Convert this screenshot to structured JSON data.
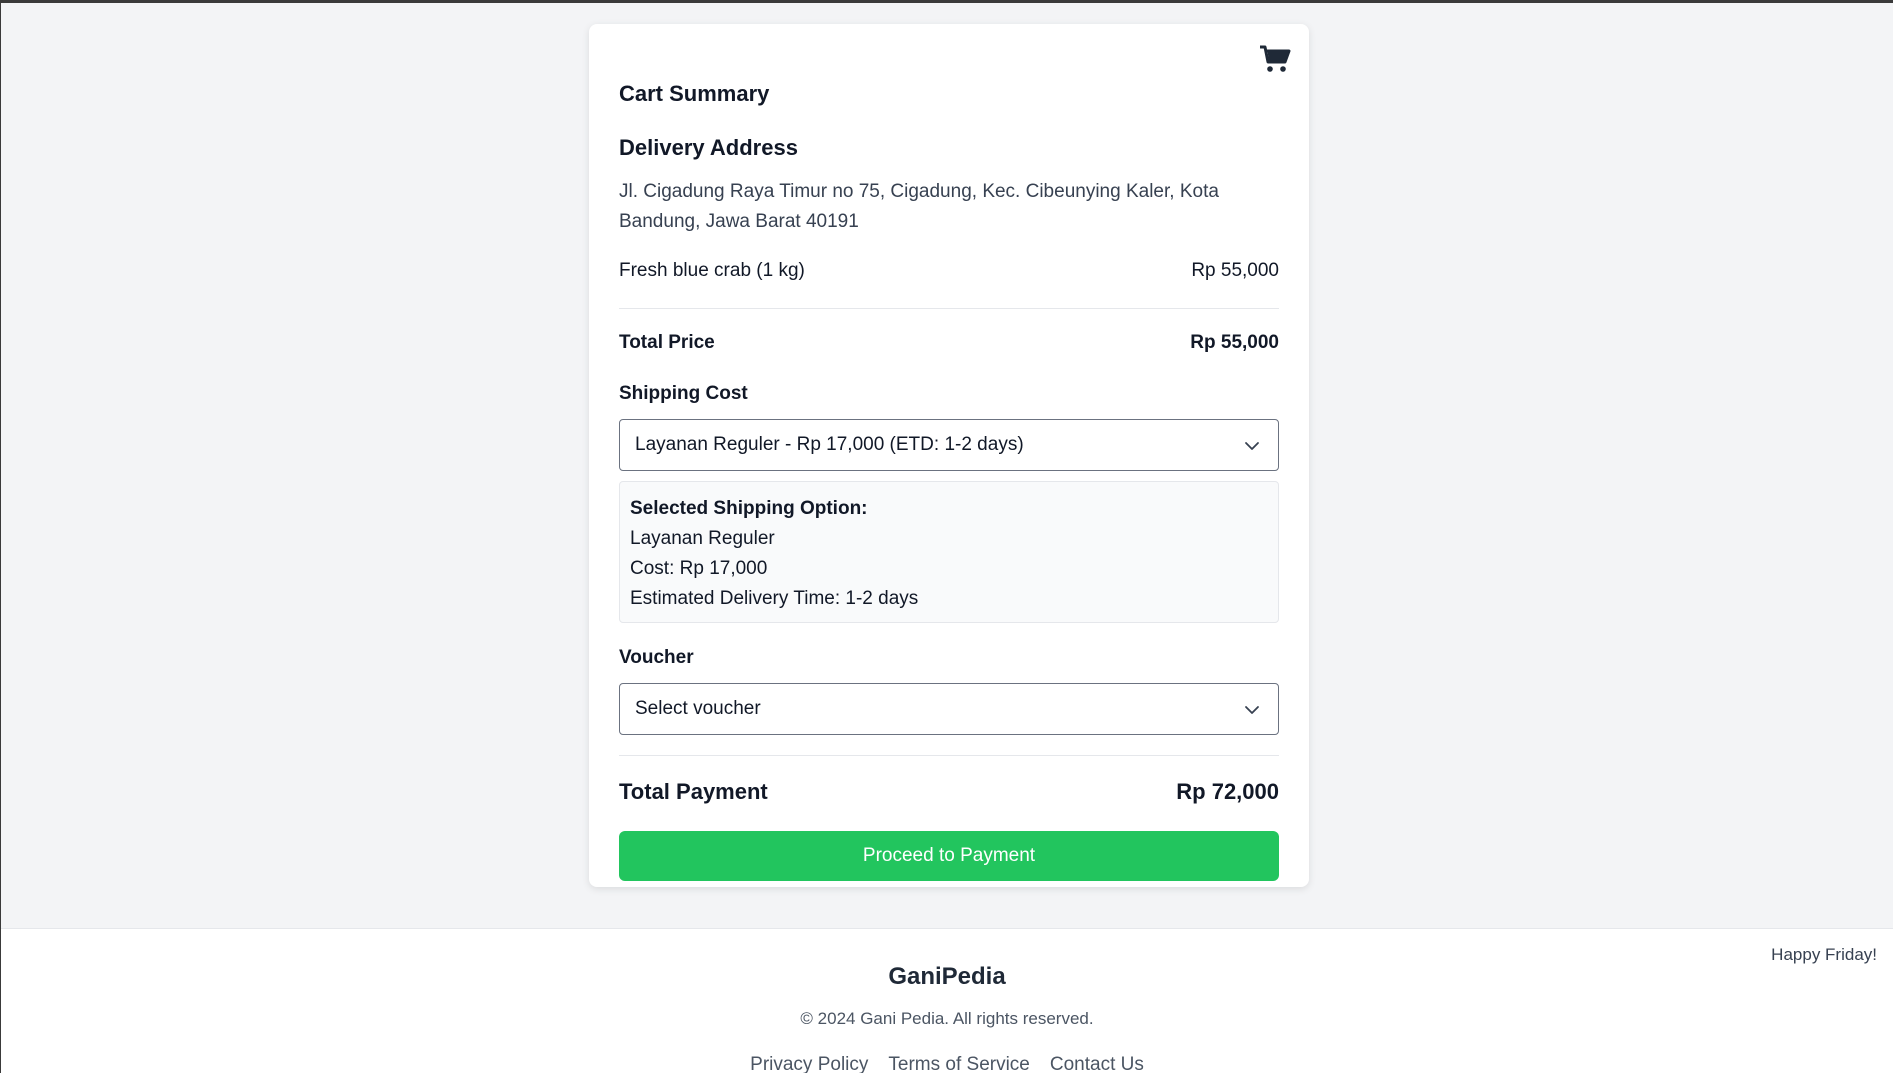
{
  "cart": {
    "title": "Cart Summary",
    "icon": "shopping-cart-icon"
  },
  "delivery": {
    "title": "Delivery Address",
    "address": "Jl. Cigadung Raya Timur no 75, Cigadung, Kec. Cibeunying Kaler, Kota Bandung, Jawa Barat 40191"
  },
  "items": [
    {
      "name": "Fresh blue crab (1 kg)",
      "price": "Rp 55,000"
    }
  ],
  "total_price": {
    "label": "Total Price",
    "value": "Rp 55,000"
  },
  "shipping": {
    "label": "Shipping Cost",
    "selected": "Layanan Reguler - Rp 17,000 (ETD: 1-2 days)",
    "info": {
      "heading": "Selected Shipping Option:",
      "service": "Layanan Reguler",
      "cost": "Cost: Rp 17,000",
      "etd": "Estimated Delivery Time: 1-2 days"
    }
  },
  "voucher": {
    "label": "Voucher",
    "selected": "Select voucher"
  },
  "total_payment": {
    "label": "Total Payment",
    "value": "Rp 72,000"
  },
  "actions": {
    "proceed_label": "Proceed to Payment"
  },
  "colors": {
    "accent": "#22c55e",
    "background": "#f3f4f6"
  },
  "footer": {
    "greeting": "Happy Friday!",
    "brand": "GaniPedia",
    "copyright": "© 2024 Gani Pedia. All rights reserved.",
    "links": [
      "Privacy Policy",
      "Terms of Service",
      "Contact Us"
    ]
  }
}
